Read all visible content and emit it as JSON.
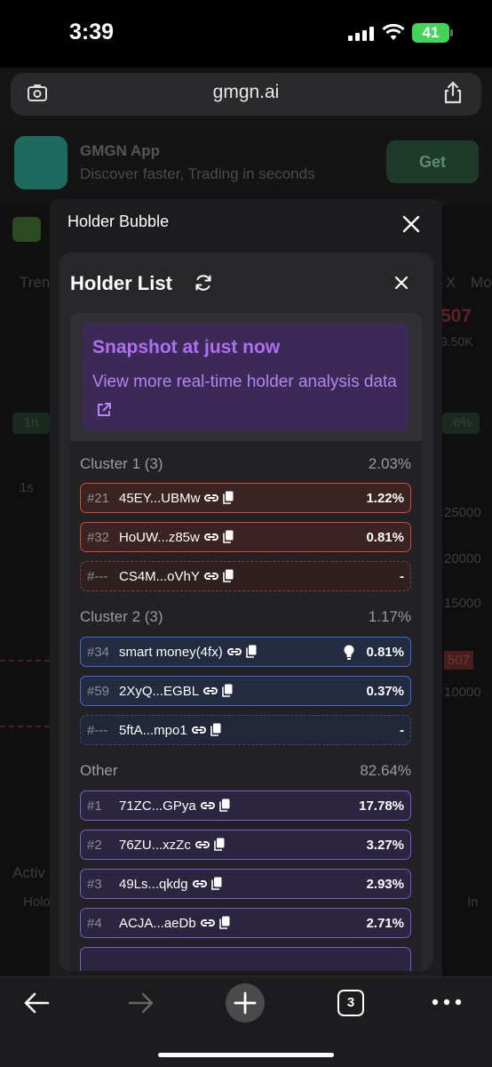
{
  "status_bar": {
    "time": "3:39",
    "battery": "41"
  },
  "browser": {
    "url": "gmgn.ai",
    "tabs_count": "3"
  },
  "banner": {
    "app_name": "GMGN App",
    "subtitle": "Discover faster, Trading in seconds",
    "get_label": "Get"
  },
  "background_page": {
    "tab_trend": "Tren",
    "tab_x": "X",
    "tab_mo": "Mo",
    "price_value": "507",
    "volume_value": "9.50K",
    "interval_1m": "1n",
    "interval_pct": ".6%",
    "interval_1s": "1s",
    "axis_1": "25000",
    "axis_2": "20000",
    "axis_3": "15000",
    "axis_4": "507",
    "axis_5": "10000",
    "activity": "Activ",
    "holder": "Holo",
    "in_label": "In"
  },
  "modal": {
    "title": "Holder Bubble"
  },
  "holder_list": {
    "title": "Holder List",
    "snapshot_title": "Snapshot at just now",
    "snapshot_link": "View more real-time holder analysis data",
    "clusters": [
      {
        "name": "Cluster 1 (3)",
        "pct": "2.03%",
        "rows": [
          {
            "rank": "#21",
            "addr": "45EY...UBMw",
            "pct": "1.22%"
          },
          {
            "rank": "#32",
            "addr": "HoUW...z85w",
            "pct": "0.81%"
          },
          {
            "rank": "#---",
            "addr": "CS4M...oVhY",
            "pct": "-"
          }
        ]
      },
      {
        "name": "Cluster 2 (3)",
        "pct": "1.17%",
        "rows": [
          {
            "rank": "#34",
            "addr": "smart money(4fx)",
            "pct": "0.81%"
          },
          {
            "rank": "#59",
            "addr": "2XyQ...EGBL",
            "pct": "0.37%"
          },
          {
            "rank": "#---",
            "addr": "5ftA...mpo1",
            "pct": "-"
          }
        ]
      },
      {
        "name": "Other",
        "pct": "82.64%",
        "rows": [
          {
            "rank": "#1",
            "addr": "71ZC...GPya",
            "pct": "17.78%"
          },
          {
            "rank": "#2",
            "addr": "76ZU...xzZc",
            "pct": "3.27%"
          },
          {
            "rank": "#3",
            "addr": "49Ls...qkdg",
            "pct": "2.93%"
          },
          {
            "rank": "#4",
            "addr": "ACJA...aeDb",
            "pct": "2.71%"
          }
        ]
      }
    ]
  },
  "colors": {
    "cluster1": "#d8492e",
    "cluster2": "#3e6ad8",
    "other": "#7b5ad0",
    "snapshot": "#b06ef5"
  }
}
